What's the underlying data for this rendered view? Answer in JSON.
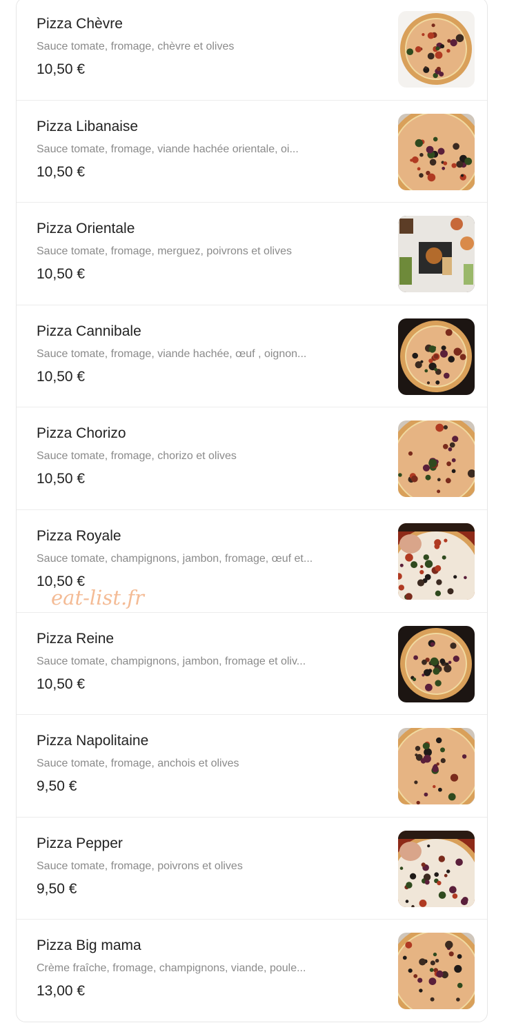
{
  "menu": {
    "items": [
      {
        "name": "Pizza Chèvre",
        "description": "Sauce tomate, fromage, chèvre et olives",
        "price": "10,50 €",
        "photo": "pizza-chevre-photo",
        "style": "whitebg"
      },
      {
        "name": "Pizza Libanaise",
        "description": "Sauce tomate, fromage, viande hachée orientale, oi...",
        "price": "10,50 €",
        "photo": "pizza-libanaise-photo",
        "style": "close"
      },
      {
        "name": "Pizza Orientale",
        "description": "Sauce tomate, fromage, merguez, poivrons et olives",
        "price": "10,50 €",
        "photo": "food-spread-photo",
        "style": "spread"
      },
      {
        "name": "Pizza Cannibale",
        "description": "Sauce tomate, fromage, viande hachée, œuf , oignon...",
        "price": "10,50 €",
        "photo": "pizza-cannibale-photo",
        "style": "dark"
      },
      {
        "name": "Pizza Chorizo",
        "description": "Sauce tomate, fromage, chorizo et olives",
        "price": "10,50 €",
        "photo": "pizza-chorizo-photo",
        "style": "close"
      },
      {
        "name": "Pizza Royale",
        "description": "Sauce tomate, champignons, jambon, fromage, œuf et...",
        "price": "10,50 €",
        "photo": "pizza-royale-photo",
        "style": "hand"
      },
      {
        "name": "Pizza Reine",
        "description": "Sauce tomate, champignons, jambon, fromage et oliv...",
        "price": "10,50 €",
        "photo": "pizza-reine-photo",
        "style": "dark"
      },
      {
        "name": "Pizza Napolitaine",
        "description": "Sauce tomate, fromage, anchois et olives",
        "price": "9,50 €",
        "photo": "pizza-napolitaine-photo",
        "style": "close"
      },
      {
        "name": "Pizza Pepper",
        "description": "Sauce tomate, fromage, poivrons et olives",
        "price": "9,50 €",
        "photo": "pizza-pepper-photo",
        "style": "hand"
      },
      {
        "name": "Pizza Big mama",
        "description": "Crème fraîche, fromage, champignons, viande, poule...",
        "price": "13,00 €",
        "photo": "pizza-big-mama-photo",
        "style": "close"
      }
    ]
  },
  "watermark": "eat-list.fr",
  "colors": {
    "title": "#222222",
    "description": "#8a8a8a",
    "watermark": "#f3b48a",
    "border": "#e6e6e6"
  }
}
